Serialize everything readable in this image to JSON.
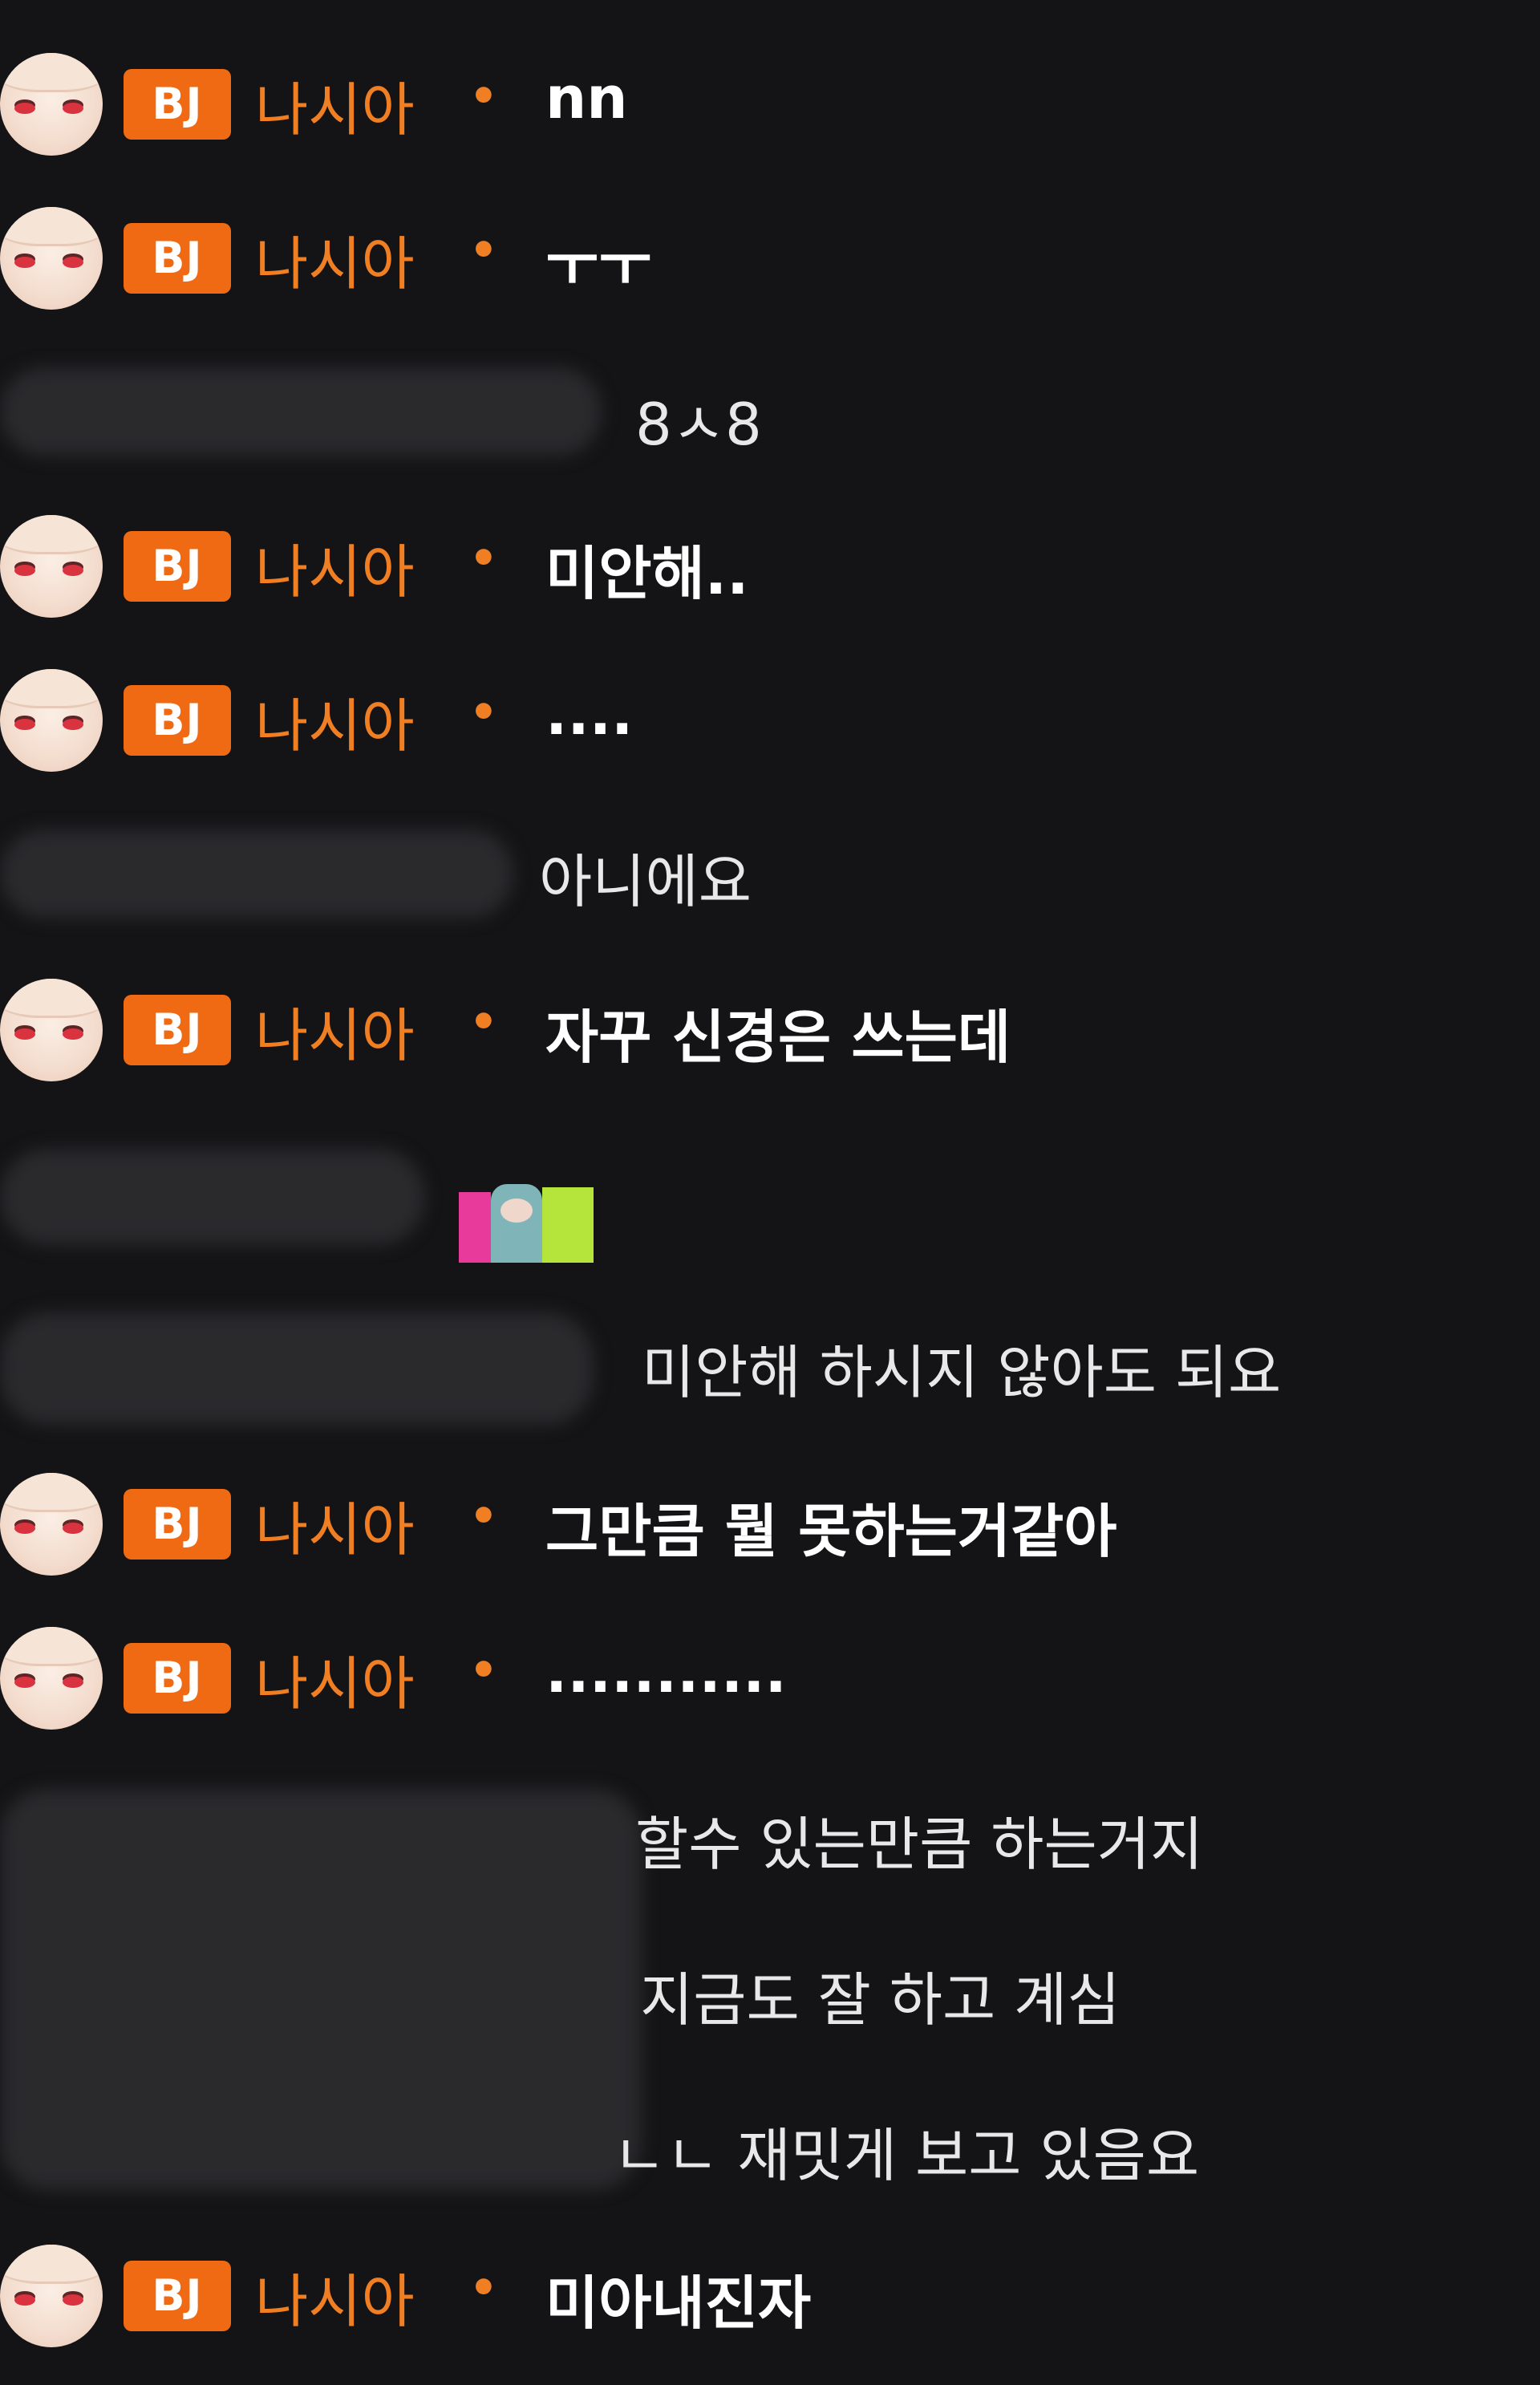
{
  "streamer": {
    "badge": "BJ",
    "nickname": "나시아",
    "separator": "•"
  },
  "messages": [
    {
      "type": "bj",
      "text": "nn"
    },
    {
      "type": "bj",
      "text": "ㅜㅜ"
    },
    {
      "type": "user",
      "text": "8ㅅ8"
    },
    {
      "type": "bj",
      "text": "미안해.."
    },
    {
      "type": "bj",
      "text": "...."
    },
    {
      "type": "user",
      "text": "아니에요"
    },
    {
      "type": "bj",
      "text": "자꾸 신경은 쓰는데"
    },
    {
      "type": "user",
      "text": "",
      "emoticon": "emote-icon"
    },
    {
      "type": "user",
      "text": "미안해 하시지 않아도 되요"
    },
    {
      "type": "bj",
      "text": "그만큼 뭘 못하는거같아"
    },
    {
      "type": "bj",
      "text": "..........."
    },
    {
      "type": "user",
      "text": "할수 있는만큼 하는거지"
    },
    {
      "type": "user",
      "text": "지금도 잘 하고 계심"
    },
    {
      "type": "user",
      "text": "ㄴㄴ 재밋게 보고 있음요"
    },
    {
      "type": "bj",
      "text": "미아내진자"
    }
  ],
  "colors": {
    "background": "#141416",
    "badge": "#f06a13",
    "nickname": "#f07e22",
    "bj_text": "#ffffff",
    "user_text": "#e8e8e8"
  }
}
